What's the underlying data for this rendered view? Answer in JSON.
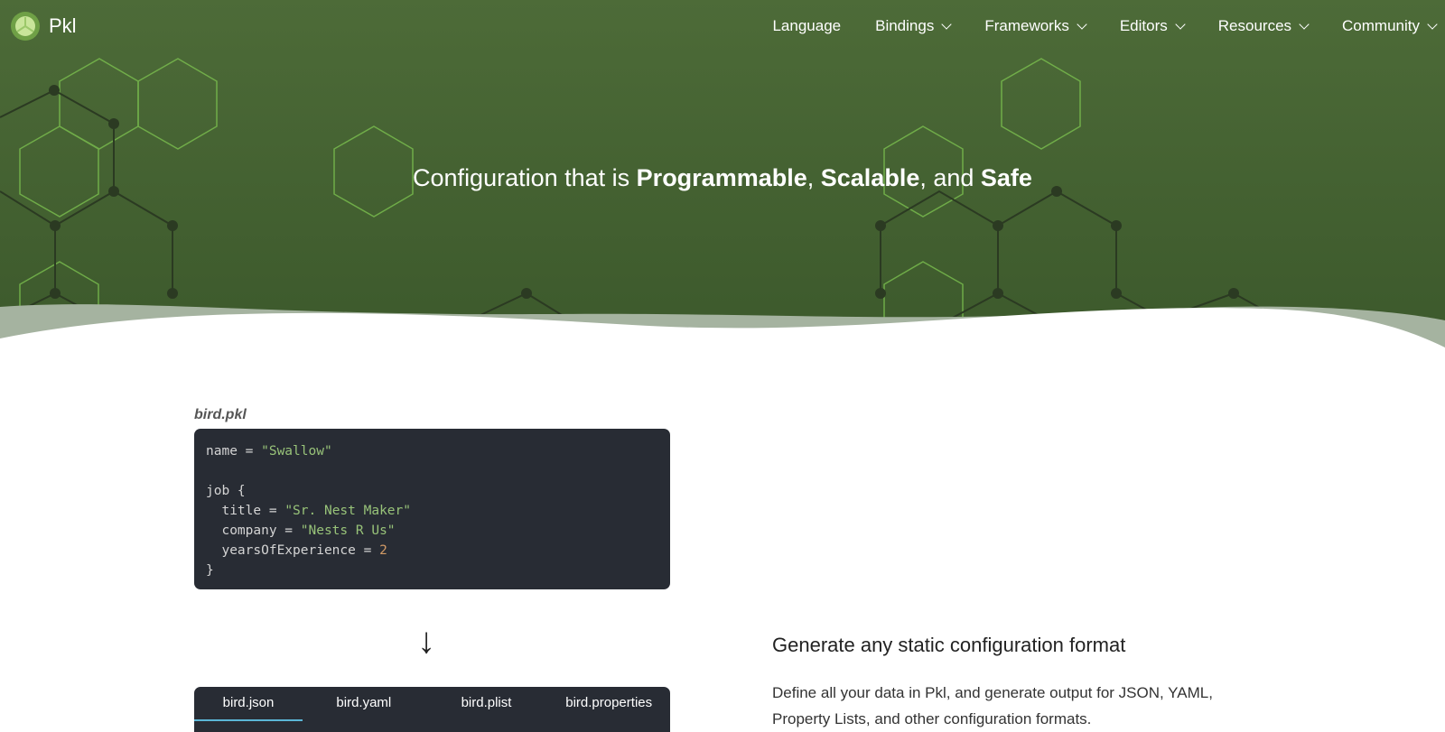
{
  "header": {
    "brand": "Pkl",
    "nav": [
      {
        "label": "Language",
        "dropdown": false
      },
      {
        "label": "Bindings",
        "dropdown": true
      },
      {
        "label": "Frameworks",
        "dropdown": true
      },
      {
        "label": "Editors",
        "dropdown": true
      },
      {
        "label": "Resources",
        "dropdown": true
      },
      {
        "label": "Community",
        "dropdown": true
      }
    ]
  },
  "hero": {
    "prefix": "Configuration that is ",
    "w1": "Programmable",
    "sep1": ", ",
    "w2": "Scalable",
    "sep2": ", and ",
    "w3": "Safe"
  },
  "example": {
    "filename": "bird.pkl",
    "code": {
      "l1a": "name = ",
      "l1b": "\"Swallow\"",
      "l3": "job {",
      "l4a": "  title = ",
      "l4b": "\"Sr. Nest Maker\"",
      "l5a": "  company = ",
      "l5b": "\"Nests R Us\"",
      "l6a": "  yearsOfExperience = ",
      "l6b": "2",
      "l7": "}"
    },
    "tabs": [
      "bird.json",
      "bird.yaml",
      "bird.plist",
      "bird.properties"
    ]
  },
  "feature": {
    "title": "Generate any static configuration format",
    "body": "Define all your data in Pkl, and generate output for JSON, YAML, Property Lists, and other configuration formats."
  },
  "colors": {
    "hero": "#4d6b38",
    "code_bg": "#282c34",
    "string": "#98c379",
    "number": "#d19a66",
    "tab_active": "#5bb6d6"
  }
}
